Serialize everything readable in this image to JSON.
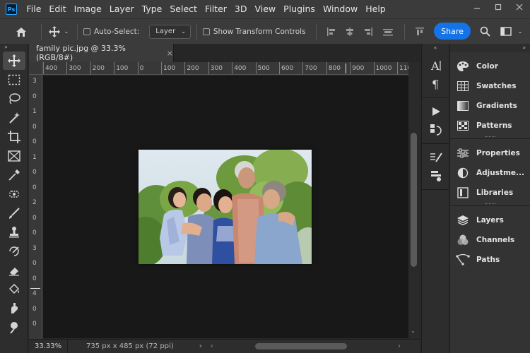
{
  "app": {
    "logo": "Ps"
  },
  "menu": [
    "File",
    "Edit",
    "Image",
    "Layer",
    "Type",
    "Select",
    "Filter",
    "3D",
    "View",
    "Plugins",
    "Window",
    "Help"
  ],
  "options": {
    "auto_select_label": "Auto-Select:",
    "layer_select_value": "Layer",
    "transform_label": "Show Transform Controls",
    "share_label": "Share"
  },
  "document": {
    "tab_title": "family pic.jpg @ 33.3% (RGB/8#)",
    "close_glyph": "×"
  },
  "ruler": {
    "h_labels": [
      "400",
      "300",
      "200",
      "100",
      "0",
      "100",
      "200",
      "300",
      "400",
      "500",
      "600",
      "700",
      "800",
      "900",
      "1000",
      "110"
    ],
    "v_labels": [
      "3",
      "0",
      "1",
      "0",
      "0",
      "1",
      "0",
      "0",
      "2",
      "0",
      "0",
      "3",
      "0",
      "0",
      "4",
      "0",
      "0"
    ]
  },
  "status": {
    "zoom": "33.33%",
    "doc_info": "735 px x 485 px (72 ppi)"
  },
  "panels": {
    "group1": [
      "Color",
      "Swatches",
      "Gradients",
      "Patterns"
    ],
    "group2": [
      "Properties",
      "Adjustme...",
      "Libraries"
    ],
    "group3": [
      "Layers",
      "Channels",
      "Paths"
    ]
  },
  "colors": {
    "accent": "#1473e6",
    "canvas": "#181818",
    "chrome": "#3b3b3b"
  }
}
